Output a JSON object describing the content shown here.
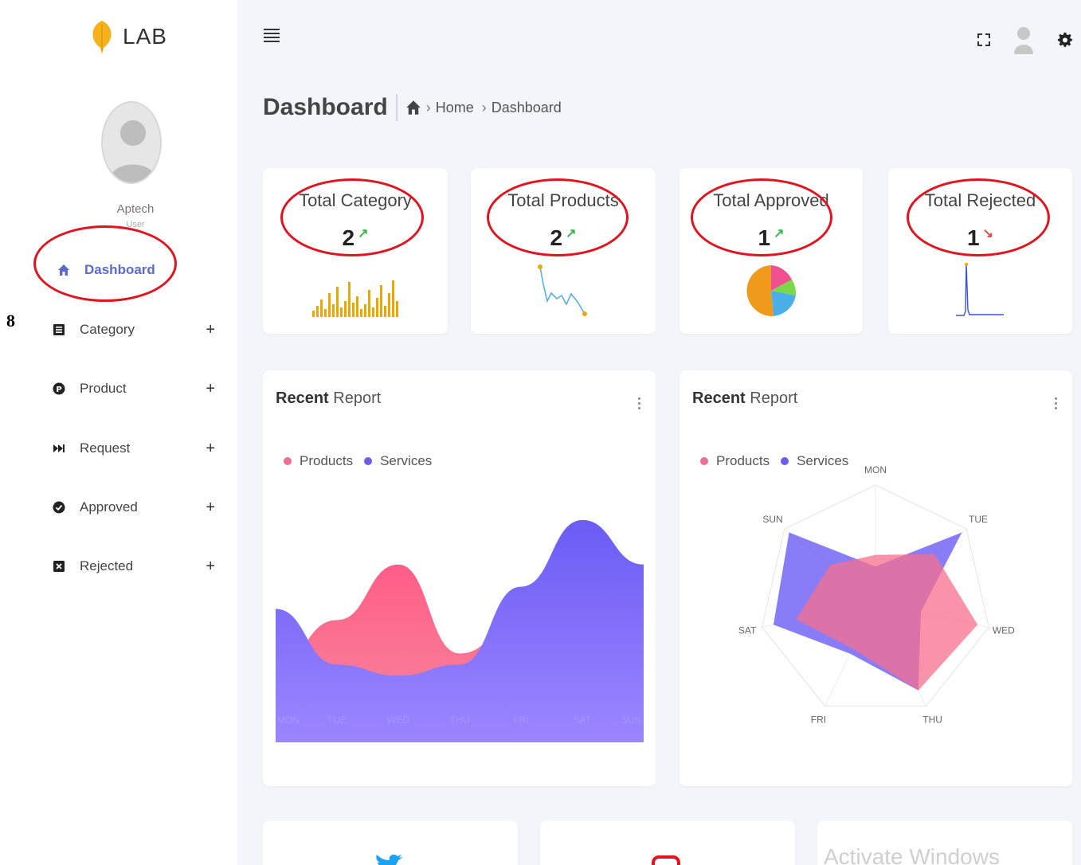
{
  "app": {
    "logo_text": "LAB",
    "leaf_color": "#f5b21b"
  },
  "margin_number": "8",
  "user": {
    "name": "Aptech",
    "role": "User"
  },
  "nav": {
    "items": [
      {
        "label": "Dashboard",
        "icon": "home-icon",
        "active": true
      },
      {
        "label": "Category",
        "icon": "list-icon",
        "expand": "+"
      },
      {
        "label": "Product",
        "icon": "product-p-icon",
        "expand": "+"
      },
      {
        "label": "Request",
        "icon": "fast-forward-icon",
        "expand": "+"
      },
      {
        "label": "Approved",
        "icon": "check-circle-icon",
        "expand": "+"
      },
      {
        "label": "Rejected",
        "icon": "close-square-icon",
        "expand": "+"
      }
    ]
  },
  "header": {
    "title": "Dashboard",
    "breadcrumb": [
      "Home",
      "Dashboard"
    ],
    "icons": [
      "fullscreen-icon",
      "user-avatar-icon",
      "gear-icon"
    ]
  },
  "stats": [
    {
      "title": "Total Category",
      "value": "2",
      "trend": "up",
      "trend_color": "#3cb44b",
      "chart_color": "#f0a500"
    },
    {
      "title": "Total Products",
      "value": "2",
      "trend": "up",
      "trend_color": "#3cb44b",
      "chart_color": "#5aaee0"
    },
    {
      "title": "Total Approved",
      "value": "1",
      "trend": "up",
      "trend_color": "#3cb44b"
    },
    {
      "title": "Total Rejected",
      "value": "1",
      "trend": "down",
      "trend_color": "#e34b4b",
      "chart_color": "#3b52d6"
    }
  ],
  "reports": [
    {
      "title_bold": "Recent",
      "title_rest": " Report",
      "legend": [
        {
          "name": "Products",
          "color": "#f06e8f"
        },
        {
          "name": "Services",
          "color": "#6b5cf0"
        }
      ]
    },
    {
      "title_bold": "Recent",
      "title_rest": " Report",
      "legend": [
        {
          "name": "Products",
          "color": "#f06e8f"
        },
        {
          "name": "Services",
          "color": "#6b5cf0"
        }
      ]
    }
  ],
  "chart_data": [
    {
      "type": "area",
      "categories": [
        "MON",
        "TUE",
        "WED",
        "THU",
        "FRI",
        "SAT",
        "SUN"
      ],
      "series": [
        {
          "name": "Products",
          "values": [
            35,
            55,
            80,
            40,
            55,
            65,
            80
          ]
        },
        {
          "name": "Services",
          "values": [
            60,
            35,
            30,
            35,
            70,
            100,
            80
          ]
        }
      ],
      "ylim": [
        0,
        110
      ]
    },
    {
      "type": "radar",
      "categories": [
        "MON",
        "TUE",
        "WED",
        "THU",
        "FRI",
        "SAT",
        "SUN"
      ],
      "series": [
        {
          "name": "Products",
          "values": [
            40,
            65,
            90,
            85,
            45,
            70,
            50
          ]
        },
        {
          "name": "Services",
          "values": [
            30,
            95,
            40,
            85,
            50,
            90,
            95
          ]
        }
      ],
      "ylim": [
        0,
        100
      ]
    }
  ],
  "watermark": "Activate Windows"
}
